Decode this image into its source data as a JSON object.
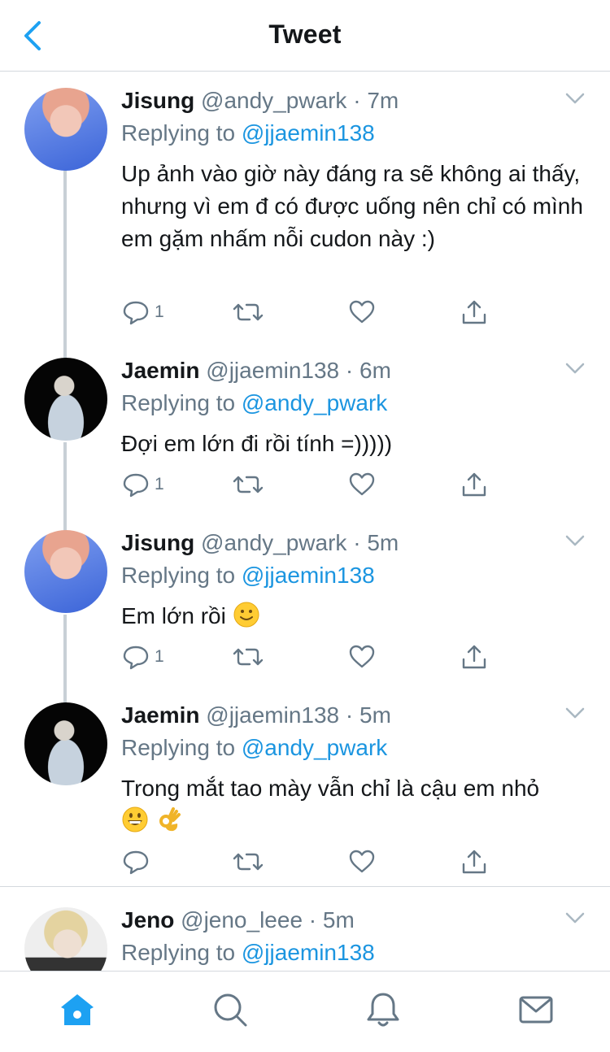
{
  "header": {
    "title": "Tweet"
  },
  "tweets": [
    {
      "name": "Jisung",
      "handle": "@andy_pwark",
      "dot": "·",
      "time": "7m",
      "replying_prefix": "Replying to",
      "replying_to": "@jjaemin138",
      "text": "Up ảnh vào giờ này đáng ra sẽ không ai thấy, nhưng vì em đ có được uống nên chỉ có mình em gặm nhấm nỗi cudon này :)",
      "reply_count": "1"
    },
    {
      "name": "Jaemin",
      "handle": "@jjaemin138",
      "dot": "·",
      "time": "6m",
      "replying_prefix": "Replying to",
      "replying_to": "@andy_pwark",
      "text": "Đợi em lớn đi rồi tính =)))))",
      "reply_count": "1"
    },
    {
      "name": "Jisung",
      "handle": "@andy_pwark",
      "dot": "·",
      "time": "5m",
      "replying_prefix": "Replying to",
      "replying_to": "@jjaemin138",
      "text": "Em lớn rồi",
      "reply_count": "1"
    },
    {
      "name": "Jaemin",
      "handle": "@jjaemin138",
      "dot": "·",
      "time": "5m",
      "replying_prefix": "Replying to",
      "replying_to": "@andy_pwark",
      "text": "Trong mắt tao mày vẫn chỉ là cậu em nhỏ",
      "reply_count": ""
    },
    {
      "name": "Jeno",
      "handle": "@jeno_leee",
      "dot": "·",
      "time": "5m",
      "replying_prefix": "Replying to",
      "replying_to": "@jjaemin138"
    }
  ],
  "icons": {
    "back": "chevron-left-icon",
    "more": "chevron-down-icon",
    "reply": "reply-icon",
    "retweet": "retweet-icon",
    "like": "heart-icon",
    "share": "share-icon",
    "emoji_slight_smile": "slightly-smiling-face-emoji",
    "emoji_grin": "grinning-face-emoji",
    "emoji_ok": "ok-hand-emoji",
    "tab_home": "home-icon",
    "tab_search": "search-icon",
    "tab_notifications": "bell-icon",
    "tab_messages": "mail-icon"
  },
  "colors": {
    "accent": "#1da1f2",
    "mention": "#1b95e0",
    "secondary_text": "#657786",
    "thread_line": "#c8d0d6"
  }
}
